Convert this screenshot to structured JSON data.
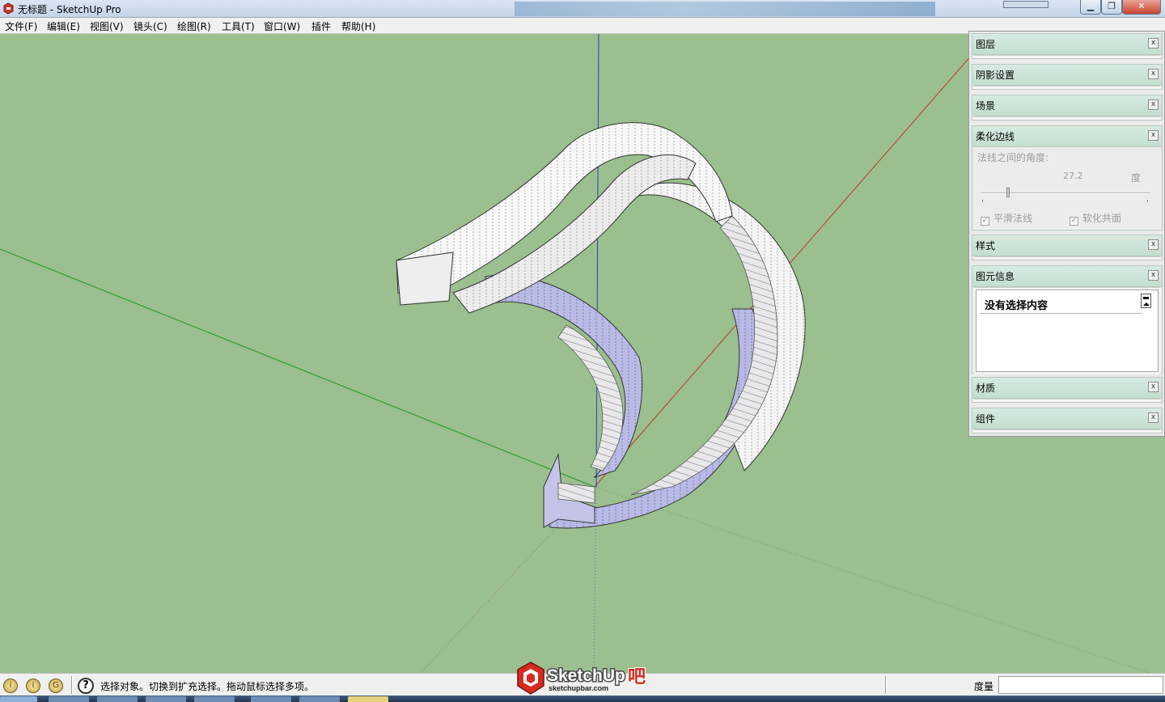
{
  "window": {
    "title": "无标题 - SketchUp Pro",
    "min_glyph": "▁",
    "max_glyph": "❐",
    "close_glyph": "✕"
  },
  "menu": [
    "文件(F)",
    "编辑(E)",
    "视图(V)",
    "镜头(C)",
    "绘图(R)",
    "工具(T)",
    "窗口(W)",
    "插件",
    "帮助(H)"
  ],
  "tray": {
    "layers": "图层",
    "shadow": "阴影设置",
    "scenes": "场景",
    "soften": {
      "title": "柔化边线",
      "angle_label": "法线之间的角度:",
      "angle_value": "27.2",
      "unit": "度",
      "smooth_normals": "平滑法线",
      "soften_coplanar": "软化共面",
      "slider_fraction": 0.16
    },
    "styles": "样式",
    "entity_info": {
      "title": "图元信息",
      "content": "没有选择内容"
    },
    "materials": "材质",
    "components": "组件",
    "close_glyph": "x"
  },
  "status": {
    "text": "选择对象。切换到扩充选择。拖动鼠标选择多项。",
    "measure_label": "度量",
    "help_glyph": "?"
  },
  "watermark": {
    "brand": "SketchUp",
    "suffix": "吧",
    "url": "sketchupbar.com"
  },
  "colors": {
    "viewport_bg": "#9bbf8f",
    "axis_red": "#c0392b",
    "axis_green": "#1f9a1f",
    "axis_blue": "#2a3fbf",
    "stair_outer": "#f4f4f4",
    "stair_inner": "#b7b9e6"
  }
}
